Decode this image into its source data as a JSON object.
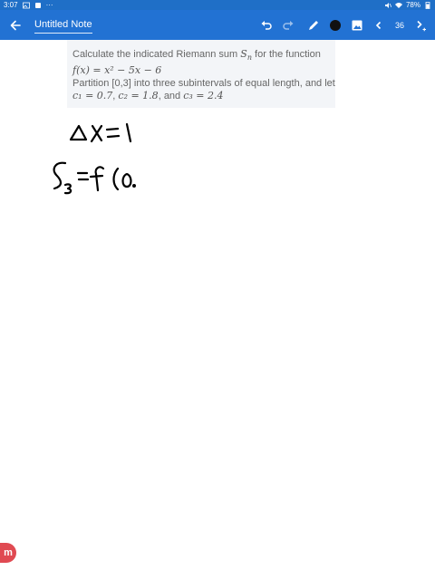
{
  "status": {
    "time": "3:07",
    "more": "···",
    "battery": "78%"
  },
  "app_bar": {
    "title": "Untitled Note",
    "page_number": "36"
  },
  "question": {
    "line1": "Calculate the indicated Riemann sum",
    "line1_symbol": "S",
    "line1_sub": "n",
    "line1_end": "for the function",
    "function": "f(x) = x² − 5x − 6",
    "line3": "Partition [0,3] into three subintervals of equal length, and let",
    "c1": "c₁ = 0.7",
    "c2": "c₂ = 1.8",
    "and": "and",
    "c3": "c₃ = 2.4"
  },
  "handwriting": {
    "line1": "Δx = 1",
    "line2": "S₃ = f(0."
  },
  "logo": {
    "letter": "m"
  }
}
